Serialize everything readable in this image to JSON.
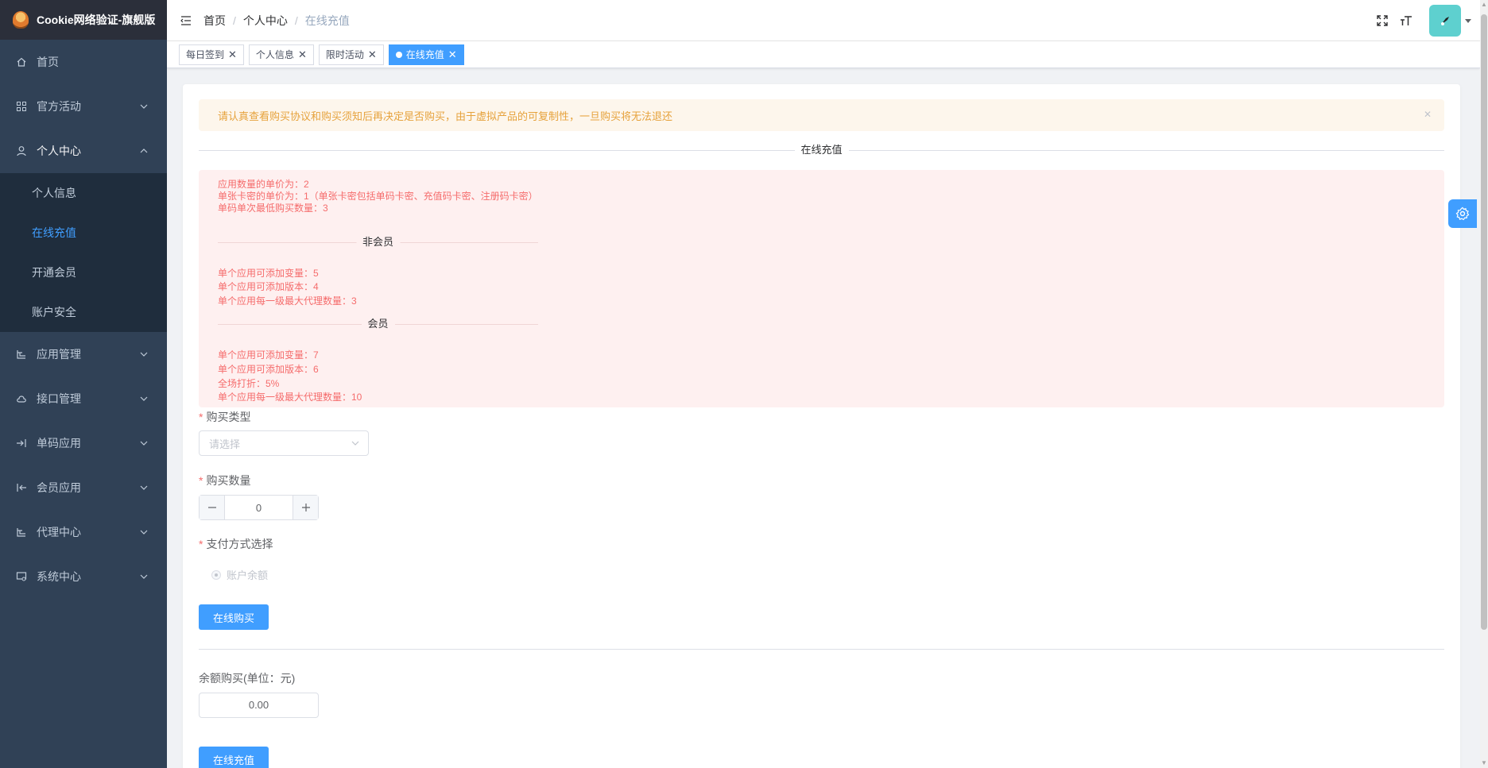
{
  "app": {
    "title": "Cookie网络验证-旗舰版"
  },
  "sidebar": {
    "items": [
      {
        "label": "首页"
      },
      {
        "label": "官方活动"
      },
      {
        "label": "个人中心"
      },
      {
        "label": "应用管理"
      },
      {
        "label": "接口管理"
      },
      {
        "label": "单码应用"
      },
      {
        "label": "会员应用"
      },
      {
        "label": "代理中心"
      },
      {
        "label": "系统中心"
      }
    ],
    "submenu": [
      {
        "label": "个人信息"
      },
      {
        "label": "在线充值",
        "active": true
      },
      {
        "label": "开通会员"
      },
      {
        "label": "账户安全"
      }
    ]
  },
  "header": {
    "breadcrumb": [
      "首页",
      "个人中心",
      "在线充值"
    ]
  },
  "tags": [
    {
      "label": "每日签到"
    },
    {
      "label": "个人信息"
    },
    {
      "label": "限时活动"
    },
    {
      "label": "在线充值",
      "active": true
    }
  ],
  "main": {
    "alert": "请认真查看购买协议和购买须知后再决定是否购买，由于虚拟产品的可复制性，一旦购买将无法退还",
    "section_title": "在线充值",
    "pricing": [
      "应用数量的单价为：2",
      "单张卡密的单价为：1（单张卡密包括单码卡密、充值码卡密、注册码卡密）",
      "单码单次最低购买数量：3"
    ],
    "non_member_title": "非会员",
    "non_member": [
      "单个应用可添加变量：5",
      "单个应用可添加版本：4",
      "单个应用每一级最大代理数量：3"
    ],
    "member_title": "会员",
    "member": [
      "单个应用可添加变量：7",
      "单个应用可添加版本：6",
      "全场打折：5%",
      "单个应用每一级最大代理数量：10"
    ],
    "purchase_type_label": "购买类型",
    "purchase_type_placeholder": "请选择",
    "quantity_label": "购买数量",
    "quantity_value": "0",
    "payment_label": "支付方式选择",
    "payment_option": "账户余额",
    "buy_button": "在线购买",
    "balance_label": "余额购买(单位：元)",
    "balance_value": "0.00",
    "recharge_button": "在线充值"
  },
  "colors": {
    "primary": "#409eff",
    "sidebar_bg": "#304156",
    "submenu_bg": "#1f2d3d",
    "warning": "#e6a23c",
    "danger": "#f56c6c"
  }
}
